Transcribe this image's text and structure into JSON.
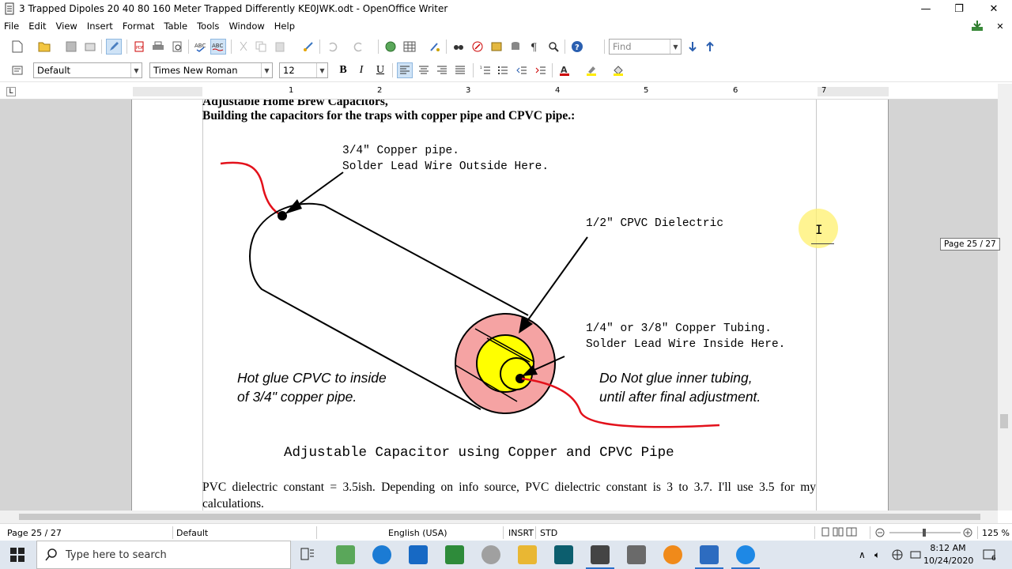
{
  "window": {
    "title": "3 Trapped Dipoles 20 40 80 160 Meter Trapped Differently KE0JWK.odt - OpenOffice Writer",
    "minimize": "—",
    "restore": "❐",
    "close": "✕"
  },
  "menu": {
    "items": [
      {
        "label": "File"
      },
      {
        "label": "Edit"
      },
      {
        "label": "View"
      },
      {
        "label": "Insert"
      },
      {
        "label": "Format"
      },
      {
        "label": "Table"
      },
      {
        "label": "Tools"
      },
      {
        "label": "Window"
      },
      {
        "label": "Help"
      }
    ]
  },
  "toolbar": {
    "find_placeholder": "Find"
  },
  "format_bar": {
    "style": "Default",
    "font": "Times New Roman",
    "size": "12"
  },
  "ruler": {
    "numbers": [
      "1",
      "2",
      "3",
      "4",
      "5",
      "6",
      "7"
    ]
  },
  "document": {
    "heading_cut": "Adjustable Home Brew Capacitors,",
    "heading": "Building the capacitors for the traps with copper pipe and CPVC pipe.:",
    "figure": {
      "label_copper_1": "3/4\" Copper pipe.",
      "label_copper_2": "Solder Lead Wire Outside Here.",
      "label_cpvc": "1/2\" CPVC Dielectric",
      "label_tubing_1": "1/4\" or 3/8\" Copper Tubing.",
      "label_tubing_2": "Solder Lead Wire Inside Here.",
      "note_left_1": "Hot glue CPVC to inside",
      "note_left_2": "of 3/4\" copper pipe.",
      "note_right_1": "Do Not glue inner tubing,",
      "note_right_2": "until after final adjustment.",
      "caption": "Adjustable Capacitor using Copper and CPVC Pipe",
      "colors": {
        "wire": "#e3111b",
        "outer": "#f5a3a3",
        "inner": "#ffff00",
        "line": "#000000"
      }
    },
    "paragraph": "PVC dielectric constant = 3.5ish. Depending on info source, PVC dielectric constant is 3 to 3.7. I'll use 3.5 for my calculations."
  },
  "page_tooltip": "Page 25 / 27",
  "status": {
    "page": "Page 25 / 27",
    "style": "Default",
    "language": "English (USA)",
    "insert": "INSRT",
    "mode": "STD",
    "zoom": "125 %"
  },
  "taskbar": {
    "search_placeholder": "Type here to search",
    "time": "8:12 AM",
    "date": "10/24/2020",
    "notification_count": "6"
  }
}
